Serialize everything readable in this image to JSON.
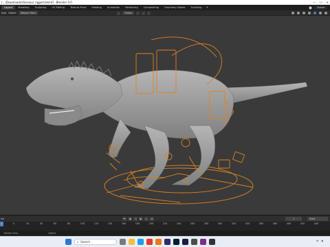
{
  "window": {
    "title": "[…\\Downloads\\dinosaur rigged.blend] - Blender 4.0",
    "controls": [
      "—",
      "☐",
      "✕"
    ]
  },
  "workspaces": [
    "Layout",
    "Modeling",
    "Sculpting",
    "UV Editing",
    "Texture Paint",
    "Shading",
    "Animation",
    "Rendering",
    "Compositing",
    "Geometry Nodes",
    "Scripting"
  ],
  "workspace_add": "+",
  "scene": {
    "label": "Scene"
  },
  "viewport_header": {
    "menus": [
      "Add",
      "Object"
    ],
    "mode": "Weight Paint",
    "orientation": "Global"
  },
  "timeline": {
    "left_label": "ew",
    "current_frame": "1",
    "start_label": "Start",
    "frame_ticks": [
      "0",
      "20",
      "40",
      "60",
      "80",
      "100",
      "120",
      "140",
      "160",
      "180",
      "200",
      "220",
      "240",
      "260",
      "280",
      "300",
      "320",
      "340",
      "360",
      "380",
      "400",
      "420",
      "440",
      "460",
      "480"
    ],
    "playhead_frame": "1"
  },
  "statusbar": {
    "left": "Rotate View",
    "mid": "Object"
  },
  "taskbar": {
    "search_placeholder": "Search",
    "clock": ""
  },
  "colors": {
    "rig": "#e0821e",
    "mesh": "#9c9c9c",
    "accent": "#4a7fc1"
  }
}
